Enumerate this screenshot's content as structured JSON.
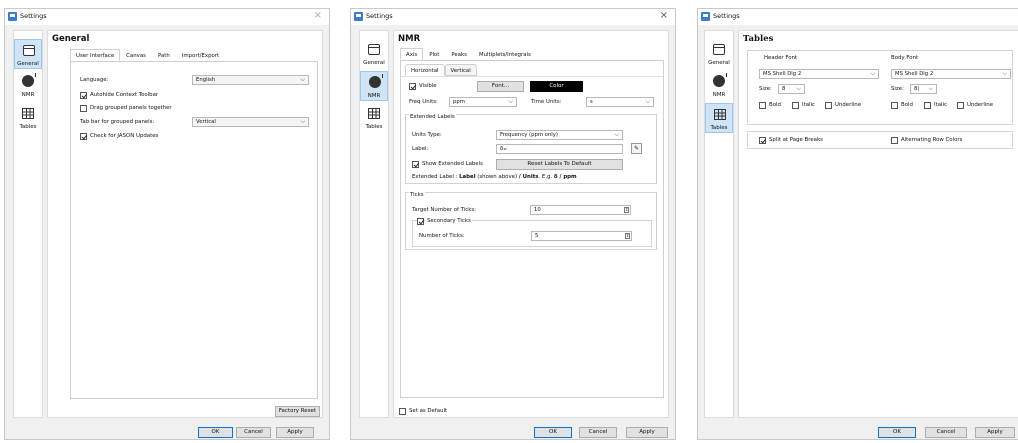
{
  "window_title": "Settings",
  "close_glyph": "×",
  "sidebar": {
    "general": "General",
    "nmr": "NMR",
    "tables": "Tables"
  },
  "buttons": {
    "ok": "OK",
    "cancel": "Cancel",
    "apply": "Apply"
  },
  "general": {
    "page_title": "General",
    "tabs": [
      "User Interface",
      "Canvas",
      "Path",
      "Import/Export"
    ],
    "language_label": "Language:",
    "language_value": "English",
    "autohide_label": "Autohide Context Toolbar",
    "autohide_checked": true,
    "drag_label": "Drag grouped panels together",
    "drag_checked": false,
    "tabbar_label": "Tab bar for grouped panels:",
    "tabbar_value": "Vertical",
    "updates_label": "Check for JASON Updates",
    "updates_checked": true,
    "factory_reset": "Factory Reset"
  },
  "nmr": {
    "page_title": "NMR",
    "tabs": [
      "Axis",
      "Plot",
      "Peaks",
      "Multiplets/Integrals"
    ],
    "subtabs": [
      "Horizontal",
      "Vertical"
    ],
    "visible_label": "Visible",
    "visible_checked": true,
    "font_button": "Font...",
    "color_button": "Color",
    "color_value": "#000000",
    "freq_units_label": "Freq Units:",
    "freq_units_value": "ppm",
    "time_units_label": "Time Units:",
    "time_units_value": "s",
    "extended_labels_title": "Extended Labels",
    "units_type_label": "Units Type:",
    "units_type_value": "Frequency (ppm only)",
    "label_label": "Label:",
    "label_value": "δ₁ₕ",
    "show_ext_label": "Show Extended Labels",
    "show_ext_checked": true,
    "reset_labels_button": "Reset Labels To Default",
    "ext_prefix": "Extended Label : ",
    "ext_label_bold": "Label",
    "ext_shown": " (shown above) ",
    "ext_units_bold": "/ Units",
    "ext_eg": ". E.g. ",
    "ext_example_bold": "δ / ppm",
    "ticks_title": "Ticks",
    "target_ticks_label": "Target Number of Ticks:",
    "target_ticks_value": "10",
    "secondary_ticks_label": "Secondary Ticks",
    "secondary_ticks_checked": true,
    "num_ticks_label": "Number of Ticks:",
    "num_ticks_value": "5",
    "set_default_label": "Set as Default",
    "set_default_checked": false
  },
  "tables": {
    "page_title": "Tables",
    "header_font_title": "Header Font",
    "body_font_title": "Body Font",
    "header_font_value": "MS Shell Dlg 2",
    "body_font_value": "MS Shell Dlg 2",
    "size_label": "Size:",
    "header_size_value": "8",
    "body_size_value": "8|",
    "bold_label": "Bold",
    "italic_label": "Italic",
    "underline_label": "Underline",
    "split_label": "Split at Page Breaks",
    "split_checked": true,
    "alt_rows_label": "Alternating Row Colors",
    "alt_rows_checked": false
  }
}
